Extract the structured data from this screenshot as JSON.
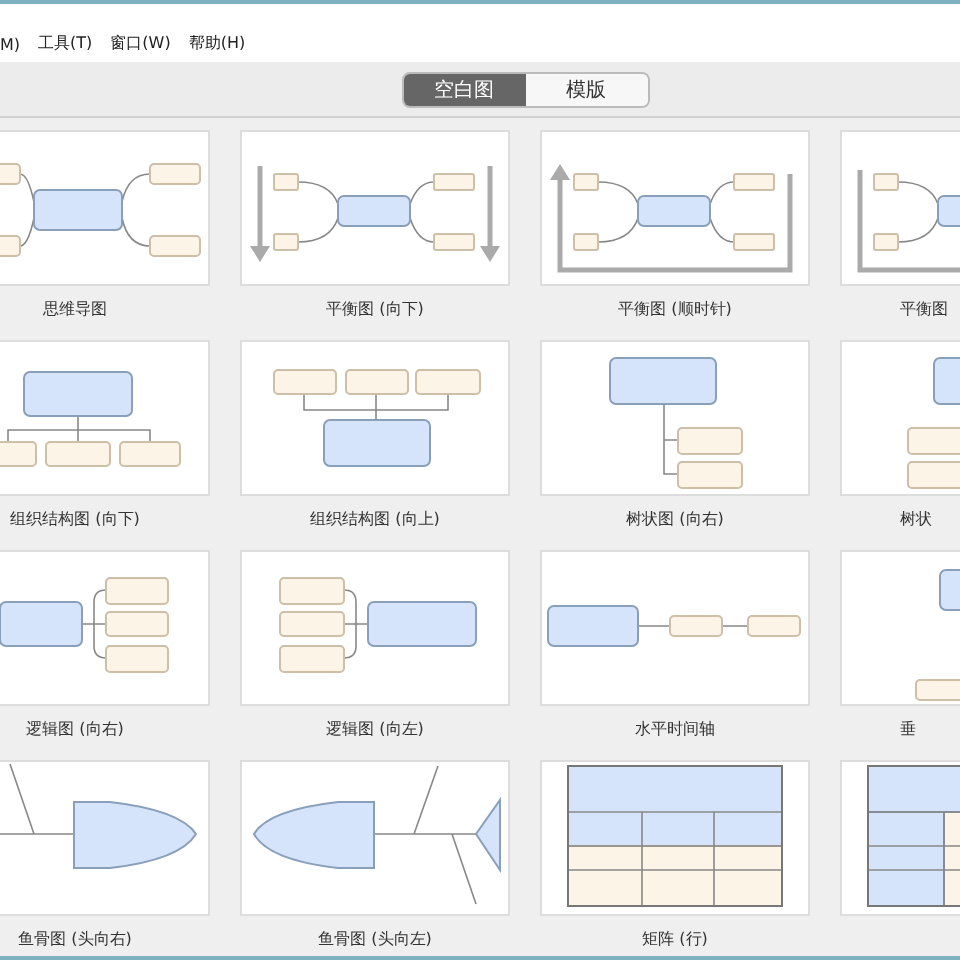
{
  "menu": [
    "M)",
    "工具(T)",
    "窗口(W)",
    "帮助(H)"
  ],
  "tabs": [
    {
      "label": "空白图",
      "selected": true
    },
    {
      "label": "模版",
      "selected": false
    }
  ],
  "templates": [
    {
      "kind": "mindmap",
      "label": "思维导图"
    },
    {
      "kind": "balance-down",
      "label": "平衡图 (向下)"
    },
    {
      "kind": "balance-cw",
      "label": "平衡图 (顺时针)"
    },
    {
      "kind": "balance-ccw",
      "label": "平衡图"
    },
    {
      "kind": "org-down",
      "label": "组织结构图 (向下)"
    },
    {
      "kind": "org-up",
      "label": "组织结构图 (向上)"
    },
    {
      "kind": "tree-right",
      "label": "树状图 (向右)"
    },
    {
      "kind": "tree-left",
      "label": "树状"
    },
    {
      "kind": "logic-right",
      "label": "逻辑图 (向右)"
    },
    {
      "kind": "logic-left",
      "label": "逻辑图 (向左)"
    },
    {
      "kind": "timeline-h",
      "label": "水平时间轴"
    },
    {
      "kind": "timeline-v",
      "label": "垂"
    },
    {
      "kind": "fishbone-right",
      "label": "鱼骨图 (头向右)"
    },
    {
      "kind": "fishbone-left",
      "label": "鱼骨图 (头向左)"
    },
    {
      "kind": "matrix-row",
      "label": "矩阵 (行)"
    },
    {
      "kind": "matrix-col"
    }
  ]
}
